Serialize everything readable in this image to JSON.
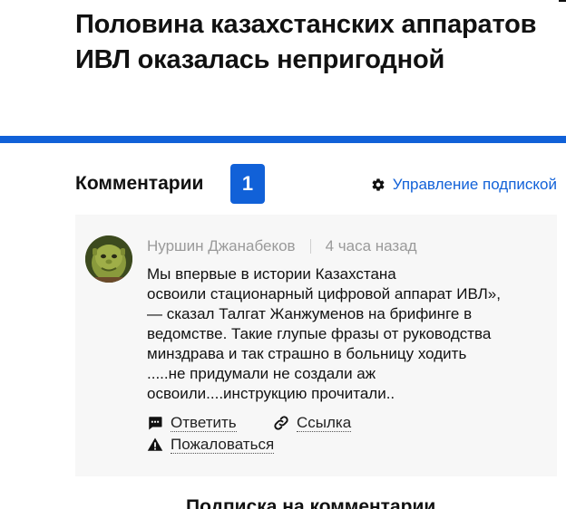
{
  "article": {
    "title": "Половина казахстанских аппаратов ИВЛ оказалась непригодной"
  },
  "comments": {
    "title": "Комментарии",
    "count": "1",
    "manage_subscription": "Управление подпиской",
    "items": [
      {
        "author": "Нуршин Джанабеков",
        "time": "4 часа назад",
        "text_lines": [
          "Мы впервые в истории Казахстана",
          "освоили стационарный цифровой аппарат ИВЛ»,",
          "— сказал Талгат Жанжуменов на брифинге в",
          "ведомстве. Такие глупые фразы от руководства",
          "минздрава и так страшно в больницу ходить",
          ".....не придумали не создали аж",
          "освоили....инструкцию прочитали.."
        ],
        "actions": {
          "reply": "Ответить",
          "link": "Ссылка",
          "report": "Пожаловаться"
        }
      }
    ]
  },
  "subscription_heading": "Подписка на комментарии",
  "colors": {
    "accent": "#1161d8",
    "card_background": "#f7f7f7",
    "meta_text": "#9a9a9a"
  },
  "icons": {
    "settings": "gear-icon",
    "reply": "comment-bubble-icon",
    "link": "link-icon",
    "report": "warning-icon"
  }
}
